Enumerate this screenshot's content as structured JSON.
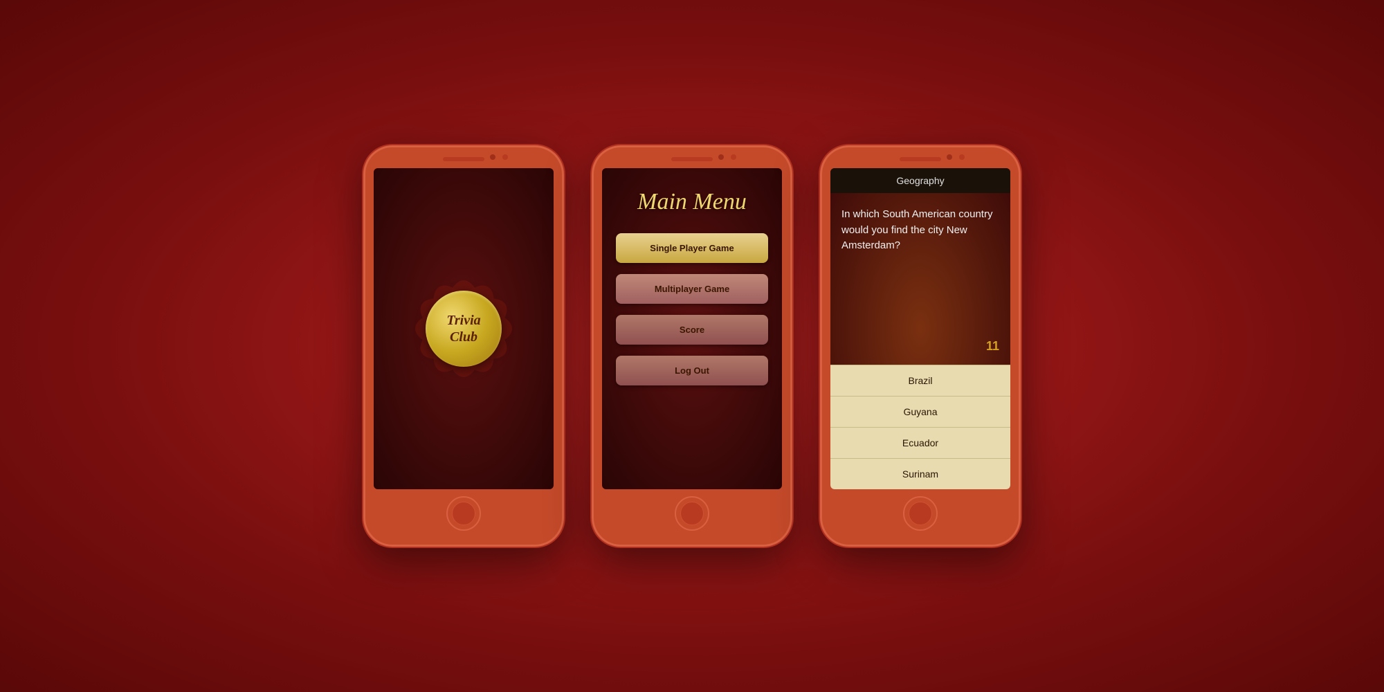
{
  "background": "#8a1010",
  "phones": [
    {
      "id": "splash",
      "logo_line1": "Trivia",
      "logo_line2": "Club"
    },
    {
      "id": "menu",
      "title": "Main Menu",
      "buttons": [
        {
          "label": "Single Player Game",
          "style": "single"
        },
        {
          "label": "Multiplayer Game",
          "style": "multi"
        },
        {
          "label": "Score",
          "style": "score"
        },
        {
          "label": "Log Out",
          "style": "logout"
        }
      ]
    },
    {
      "id": "quiz",
      "category": "Geography",
      "question": "In which South American country would you find the city New Amsterdam?",
      "timer": "11",
      "answers": [
        {
          "label": "Brazil"
        },
        {
          "label": "Guyana"
        },
        {
          "label": "Ecuador"
        },
        {
          "label": "Surinam"
        }
      ]
    }
  ]
}
